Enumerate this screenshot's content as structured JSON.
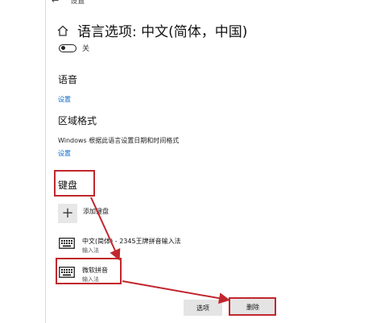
{
  "topbar": {
    "back_icon": "back-arrow-icon",
    "window_title": "设置"
  },
  "header": {
    "home_icon": "home-icon",
    "title": "语言选项: 中文(简体，中国)"
  },
  "toggle": {
    "state": "off",
    "label": "关"
  },
  "language_section": {
    "heading": "语音",
    "link": "设置"
  },
  "region_section": {
    "heading": "区域格式",
    "description": "Windows 根据此语言设置日期和时间格式",
    "link": "设置"
  },
  "keyboard_section": {
    "heading": "键盘",
    "add_keyboard_label": "添加键盘",
    "items": [
      {
        "name": "中文(简体) - 2345王牌拼音输入法",
        "sub": "输入法",
        "icon": "keyboard-icon"
      },
      {
        "name": "微软拼音",
        "sub": "输入法",
        "icon": "keyboard-icon"
      }
    ]
  },
  "actions": {
    "options_label": "选项",
    "remove_label": "删除"
  },
  "colors": {
    "link": "#0b6ac9",
    "annotation": "#c1272d",
    "button_bg": "#e4e4e4"
  }
}
